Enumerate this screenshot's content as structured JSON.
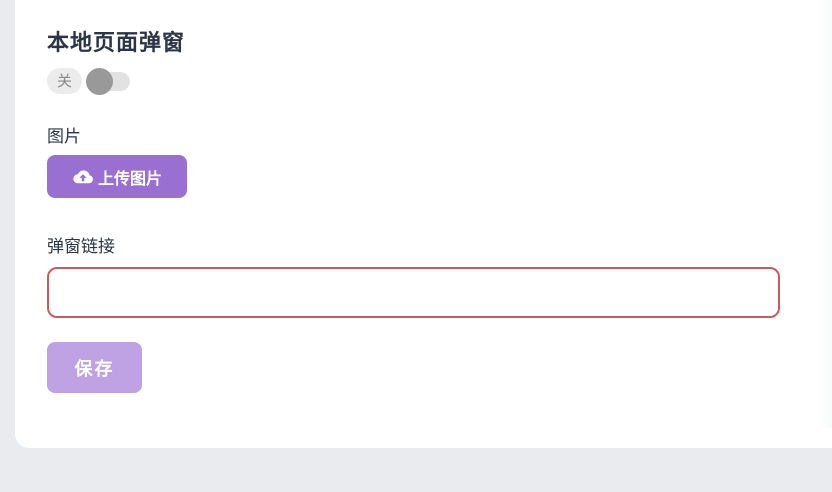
{
  "section": {
    "title": "本地页面弹窗",
    "switch_state_label": "关",
    "switch_on": false
  },
  "image_field": {
    "label": "图片",
    "upload_button_label": "上传图片",
    "upload_icon": "cloud-upload-icon"
  },
  "link_field": {
    "label": "弹窗链接",
    "value": "",
    "placeholder": ""
  },
  "actions": {
    "save_label": "保存"
  },
  "colors": {
    "accent": "#9a6fd2",
    "accent_disabled": "#bfa2e4",
    "error_border": "#c95a64",
    "title_text": "#2b3545"
  }
}
